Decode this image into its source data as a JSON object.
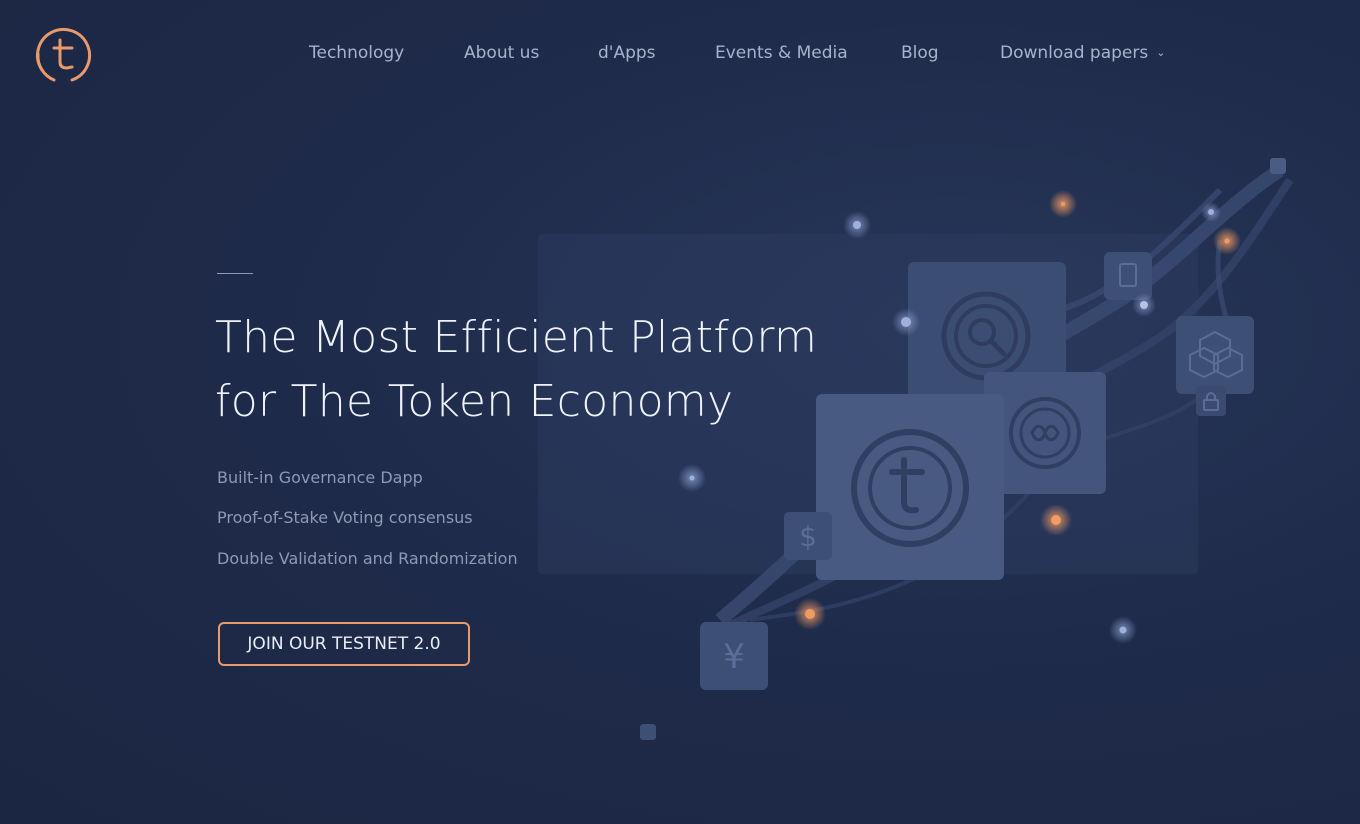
{
  "brand": {
    "logo_icon": "t-coin-logo-icon",
    "accent": "#e79a6b"
  },
  "nav": {
    "items": [
      {
        "label": "Technology"
      },
      {
        "label": "About us"
      },
      {
        "label": "d'Apps"
      },
      {
        "label": "Events & Media"
      },
      {
        "label": "Blog"
      },
      {
        "label": "Download papers",
        "icon": "chevron-down-icon"
      }
    ]
  },
  "hero": {
    "title_line1": "The Most Efficient Platform",
    "title_line2": "for The Token Economy",
    "features": [
      "Built-in Governance Dapp",
      "Proof-of-Stake Voting consensus",
      "Double Validation and Randomization"
    ],
    "cta_label": "JOIN OUR TESTNET 2.0"
  },
  "illustration": {
    "icons": [
      "search-coin-icon",
      "infinity-coin-icon",
      "t-coin-icon",
      "document-icon",
      "blocks-icon",
      "lock-icon",
      "dollar-icon",
      "yen-icon"
    ]
  },
  "colors": {
    "background": "#1f2b4a",
    "card": "#3a4a6e",
    "text_muted": "#8e99b4"
  }
}
